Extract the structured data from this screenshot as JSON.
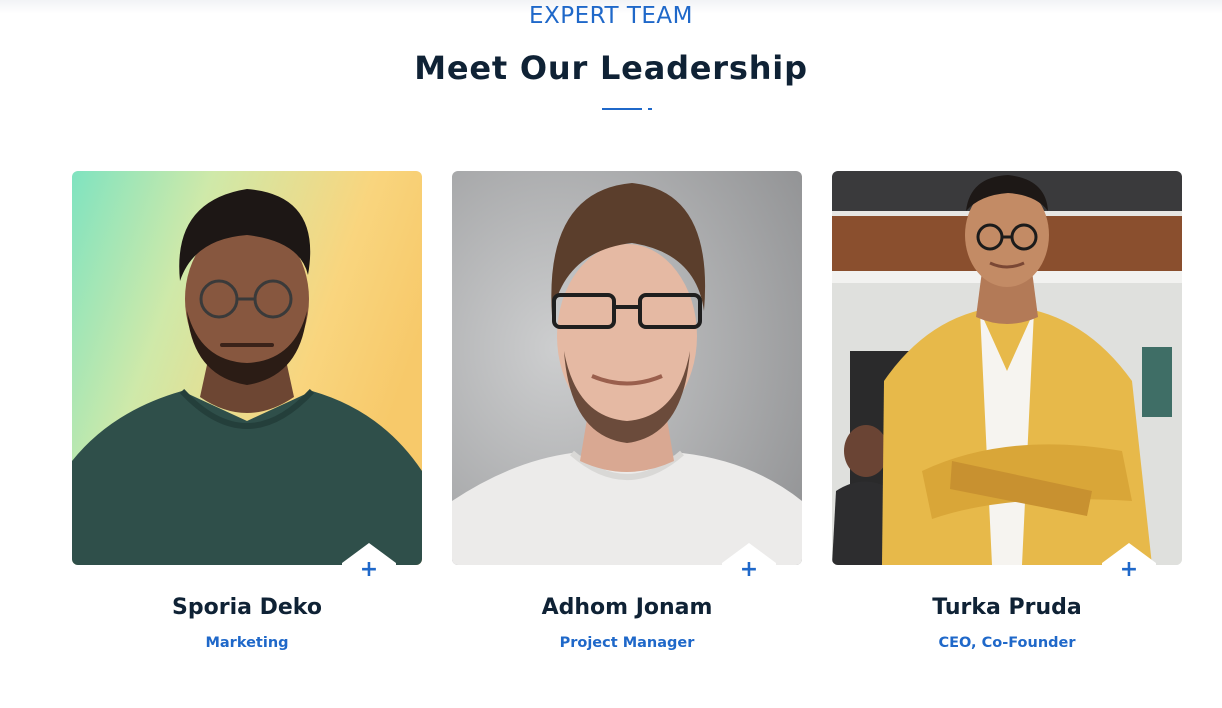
{
  "section": {
    "eyebrow": "EXPERT TEAM",
    "title": "Meet Our Leadership",
    "accent_color": "#1f68c9",
    "heading_color": "#0f2235"
  },
  "team": [
    {
      "name": "Sporia Deko",
      "role": "Marketing",
      "photo_icon": "portrait-photo",
      "action_icon": "plus-icon",
      "action_symbol": "+"
    },
    {
      "name": "Adhom Jonam",
      "role": "Project Manager",
      "photo_icon": "portrait-photo",
      "action_icon": "plus-icon",
      "action_symbol": "+"
    },
    {
      "name": "Turka Pruda",
      "role": "CEO, Co-Founder",
      "photo_icon": "portrait-photo",
      "action_icon": "plus-icon",
      "action_symbol": "+"
    }
  ]
}
